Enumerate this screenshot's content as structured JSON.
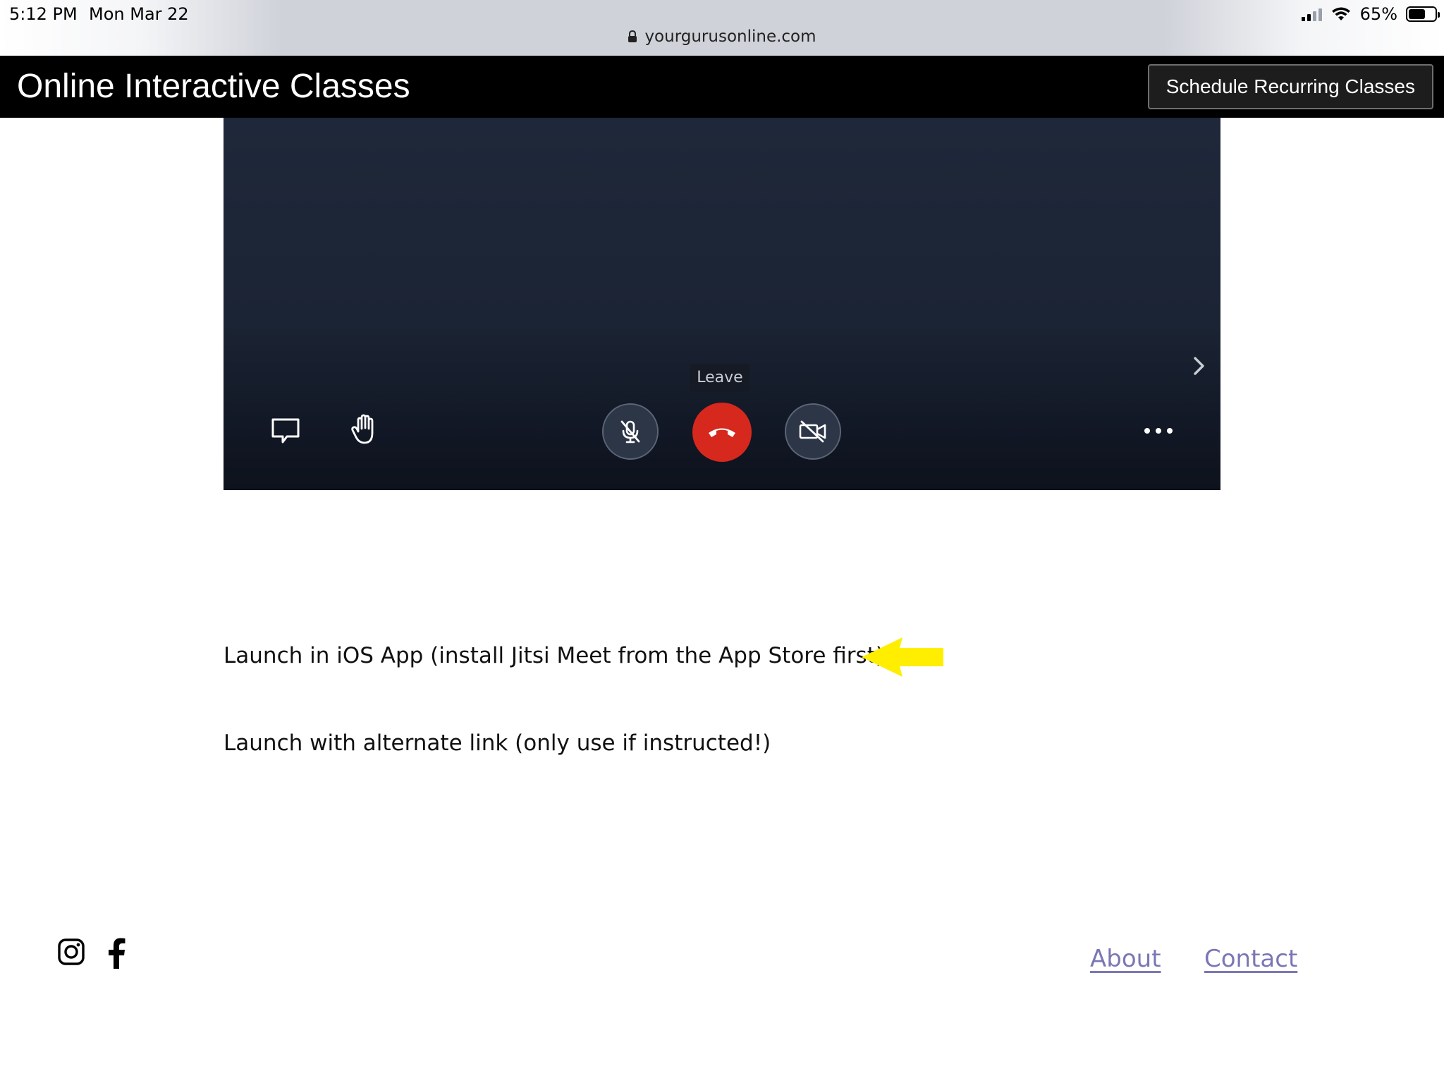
{
  "status_bar": {
    "time": "5:12 PM",
    "date": "Mon Mar 22",
    "battery_text": "65%",
    "battery_level": 0.65
  },
  "browser": {
    "url": "yourgurusonline.com"
  },
  "header": {
    "title": "Online Interactive Classes",
    "schedule_button": "Schedule Recurring Classes"
  },
  "video": {
    "leave_tooltip": "Leave",
    "icons": [
      "chat-icon",
      "raise-hand-icon",
      "microphone-muted-icon",
      "hangup-icon",
      "camera-off-icon",
      "more-options-icon",
      "chevron-right-icon"
    ]
  },
  "content": {
    "ios_link": "Launch in iOS App (install Jitsi Meet from the App Store first)",
    "alt_link": "Launch with alternate link (only use if instructed!)"
  },
  "footer": {
    "about": "About",
    "contact": "Contact"
  },
  "colors": {
    "header_bg": "#000000",
    "hangup_red": "#d6281d",
    "arrow_yellow": "#ffee00",
    "link_color": "#7a77b5"
  }
}
